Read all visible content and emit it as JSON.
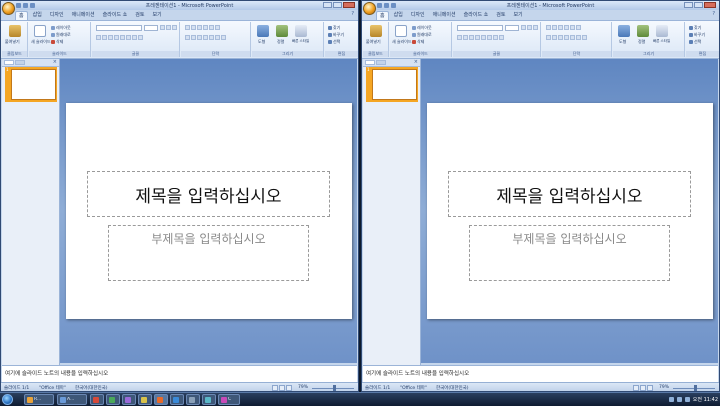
{
  "window": {
    "title": "프레젠테이션1 - Microsoft PowerPoint"
  },
  "ribbon": {
    "tabs": [
      {
        "label": "홈",
        "active": true
      },
      {
        "label": "삽입",
        "active": false
      },
      {
        "label": "디자인",
        "active": false
      },
      {
        "label": "애니메이션",
        "active": false
      },
      {
        "label": "슬라이드 쇼",
        "active": false
      },
      {
        "label": "검토",
        "active": false
      },
      {
        "label": "보기",
        "active": false
      }
    ],
    "clipboard": {
      "paste_label": "붙여넣기",
      "group_label": "클립보드"
    },
    "slides": {
      "new_slide_label": "새 슬라이드",
      "layout_label": "레이아웃",
      "reset_label": "원래대로",
      "delete_label": "삭제",
      "group_label": "슬라이드"
    },
    "font": {
      "group_label": "글꼴"
    },
    "paragraph": {
      "group_label": "단락"
    },
    "drawing": {
      "shapes_label": "도형",
      "arrange_label": "정렬",
      "quick_styles_label": "빠른 스타일",
      "group_label": "그리기"
    },
    "editing": {
      "find_label": "찾기",
      "replace_label": "바꾸기",
      "select_label": "선택",
      "group_label": "편집"
    }
  },
  "slide": {
    "title_placeholder": "제목을 입력하십시오",
    "subtitle_placeholder": "부제목을 입력하십시오"
  },
  "notes": {
    "placeholder": "여기에 슬라이드 노트의 내용을 입력하십시오"
  },
  "status": {
    "slide_info": "슬라이드 1/1",
    "theme": "\"Office 테마\"",
    "language": "한국어(대한민국)",
    "zoom": "79%"
  },
  "taskbar": {
    "items": [
      {
        "label": "R..."
      },
      {
        "label": "A..."
      },
      {
        "label": "C"
      }
    ],
    "clock": "오전 11:42"
  },
  "colors": {
    "accent": "#f5a623",
    "ribbon": "#dbe7f6",
    "workspace": "#8fadd6"
  }
}
